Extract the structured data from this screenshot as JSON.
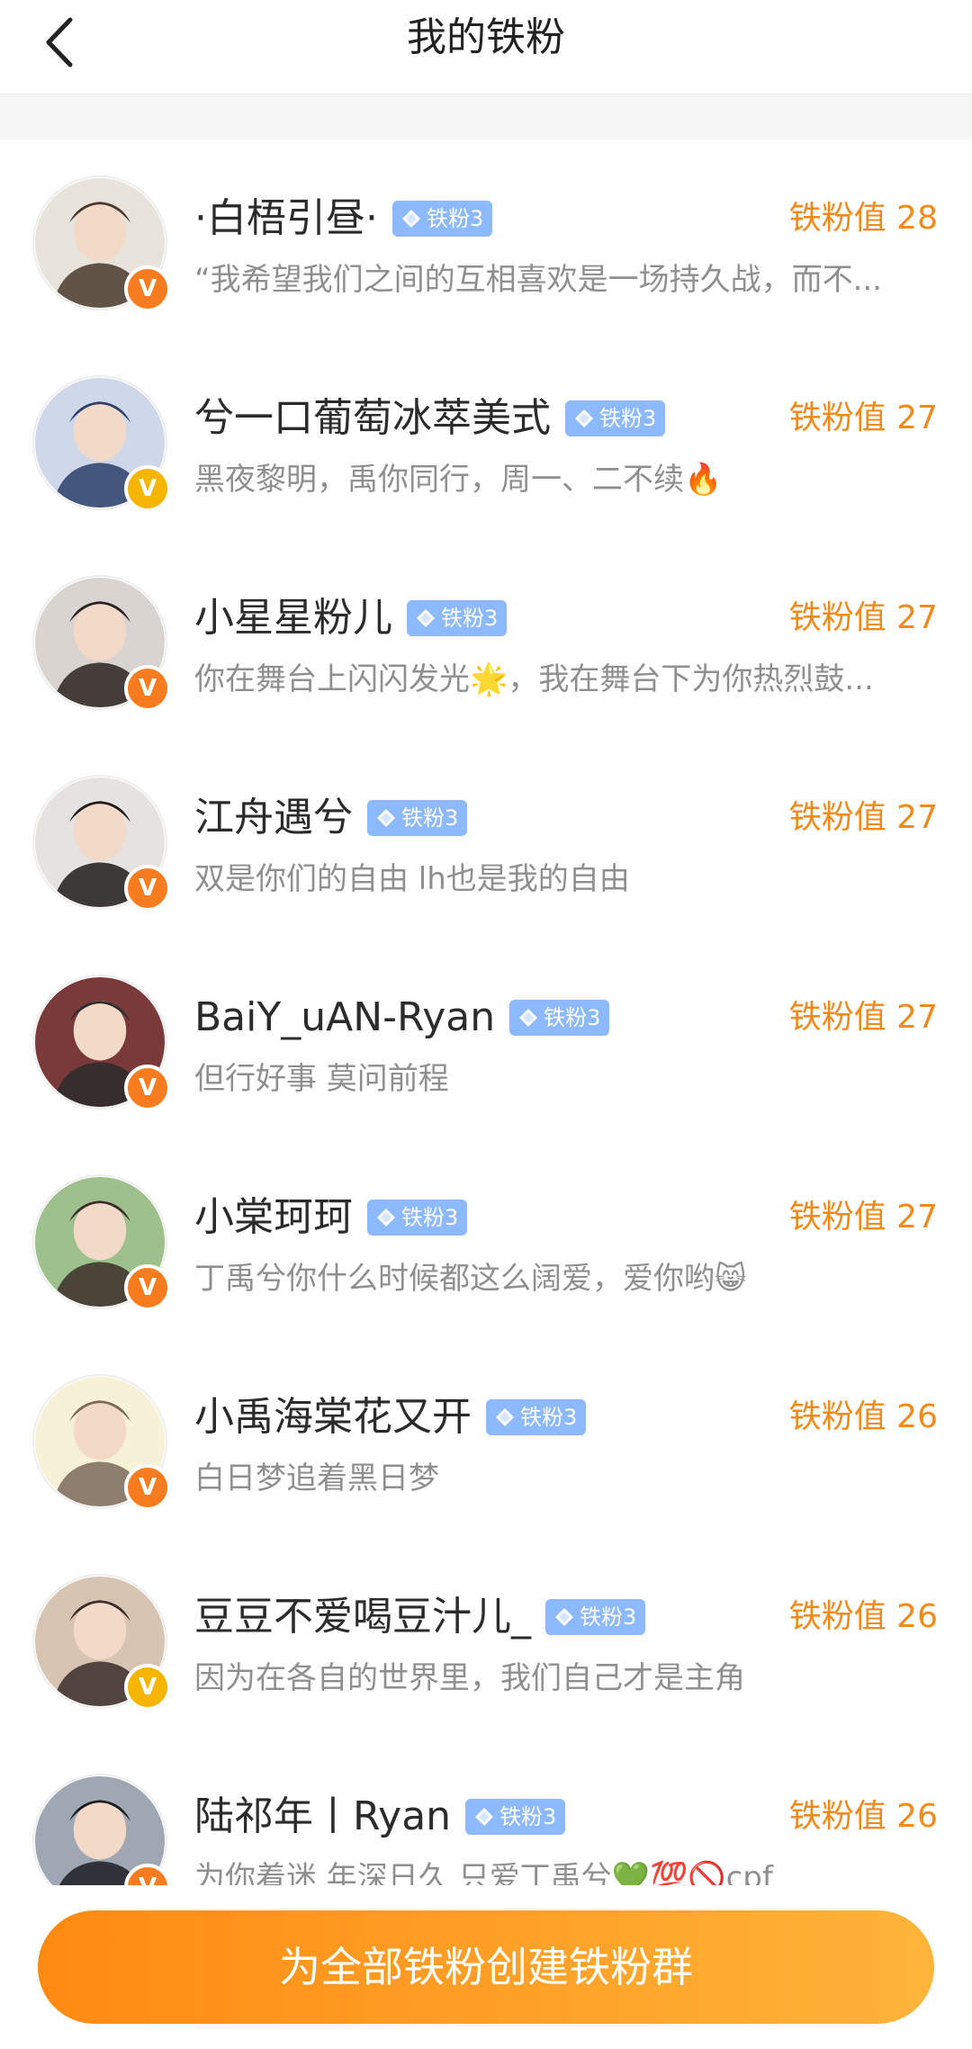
{
  "header": {
    "title": "我的铁粉",
    "back_icon": "chevron-left-icon"
  },
  "fans": [
    {
      "name": "·白梧引昼·",
      "tier": "铁粉3",
      "score": "铁粉值 28",
      "desc": "“我希望我们之间的互相喜欢是一场持久战，而不...",
      "badge": "V",
      "badge_color": "#f77b1f",
      "avatar_colors": [
        "#e8e4dc",
        "#4a3a2d"
      ]
    },
    {
      "name": "兮一口葡萄冰萃美式",
      "tier": "铁粉3",
      "score": "铁粉值 27",
      "desc": "黑夜黎明，禹你同行，周一、二不续🔥",
      "badge": "V",
      "badge_color": "#f6b500",
      "avatar_colors": [
        "#cfd8e8",
        "#2d3f6b"
      ]
    },
    {
      "name": "小星星粉儿",
      "tier": "铁粉3",
      "score": "铁粉值 27",
      "desc": "你在舞台上闪闪发光🌟，我在舞台下为你热烈鼓...",
      "badge": "V",
      "badge_color": "#f77b1f",
      "avatar_colors": [
        "#d9d4d0",
        "#2a2220"
      ]
    },
    {
      "name": "江舟遇兮",
      "tier": "铁粉3",
      "score": "铁粉值 27",
      "desc": "双是你们的自由 lh也是我的自由",
      "badge": "V",
      "badge_color": "#f77b1f",
      "avatar_colors": [
        "#e6e2e0",
        "#1f1b1a"
      ]
    },
    {
      "name": "BaiY_uAN-Ryan",
      "tier": "铁粉3",
      "score": "铁粉值 27",
      "desc": "但行好事 莫问前程",
      "badge": "V",
      "badge_color": "#f77b1f",
      "avatar_colors": [
        "#7b3a3a",
        "#2c2c2c"
      ]
    },
    {
      "name": "小棠珂珂",
      "tier": "铁粉3",
      "score": "铁粉值 27",
      "desc": "丁禹兮你什么时候都这么阔爱，爱你哟😸",
      "badge": "V",
      "badge_color": "#f77b1f",
      "avatar_colors": [
        "#9ec08c",
        "#3b2e2a"
      ]
    },
    {
      "name": "小禹海棠花又开",
      "tier": "铁粉3",
      "score": "铁粉值 26",
      "desc": "白日梦追着黑日梦",
      "badge": "V",
      "badge_color": "#f77b1f",
      "avatar_colors": [
        "#f7f1d8",
        "#7b6a5a"
      ]
    },
    {
      "name": "豆豆不爱喝豆汁儿_",
      "tier": "铁粉3",
      "score": "铁粉值 26",
      "desc": "因为在各自的世界里，我们自己才是主角",
      "badge": "V",
      "badge_color": "#f6b500",
      "avatar_colors": [
        "#d7c4b3",
        "#3a2e2a"
      ]
    },
    {
      "name": "陆祁年丨Ryan",
      "tier": "铁粉3",
      "score": "铁粉值 26",
      "desc": "为你着迷 年深日久 只爱丁禹兮💚💯🚫cpf",
      "badge": "V",
      "badge_color": "#f77b1f",
      "avatar_colors": [
        "#9fa7b3",
        "#1b1d22"
      ]
    }
  ],
  "footer": {
    "create_button_label": "为全部铁粉创建铁粉群"
  }
}
